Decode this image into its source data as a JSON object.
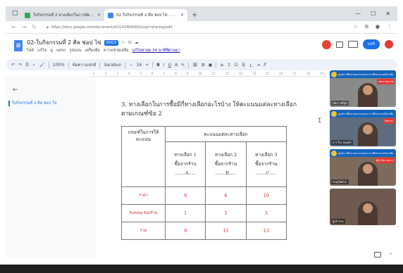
{
  "browser": {
    "tabs": [
      {
        "title": "ใบกิจกรรมที่ 2 ทางเลือกในการตัดสินใจ",
        "favicon_color": "#34a853",
        "active": false
      },
      {
        "title": "02-ใบกิจกรรมที่ 2 ศิล ช่อป ไข่ - Google เอกสาร",
        "favicon_color": "#4285f4",
        "active": true
      }
    ],
    "new_tab_glyph": "+",
    "url": "https://docs.google.com/document/d/1LXGN0b9IQi/usp=sharing/edit"
  },
  "doc": {
    "title": "02-ใบกิจกรรมที่ 2 ศิล ช่อป ไข่",
    "format_badge": "DOCX",
    "menus": [
      "ไฟล์",
      "แก้ไข",
      "ดู",
      "แทรก",
      "รูปแบบ",
      "เครื่องมือ",
      "ความช่วยเหลือ"
    ],
    "last_edit": "แก้ไขล่าสุด 34 นาทีที่ผ่านมา",
    "share_label": "แชร์"
  },
  "toolbar": {
    "zoom": "100%",
    "style": "ข้อความปกติ",
    "font": "Sarabun",
    "size": "16",
    "bold": "B",
    "italic": "I",
    "underline": "U",
    "text_color": "A"
  },
  "ruler": {
    "ticks": [
      "1",
      "2",
      "3",
      "4",
      "5",
      "6",
      "7",
      "8",
      "9",
      "10",
      "11",
      "12",
      "13",
      "14",
      "15",
      "16",
      "17",
      "18",
      "19"
    ]
  },
  "outline": {
    "item": "ใบกิจกรรมที่ 2 ศิล ช่อป ไข่"
  },
  "content": {
    "heading_line1": "3. ทางเลือกในการซื้อมีกี่ทางเลือกอะไรบ้าง ให้คะแนนแต่ละทางเลือก",
    "heading_line2": "ตามเกณฑ์ข้อ 2",
    "table": {
      "criteria_header": "เกณฑ์ในการให้คะแนน",
      "group_header": "คะแนนแต่ละทางเลือก",
      "options": [
        {
          "label": "ทางเลือก 1",
          "detail": "ซื้อจากร้าน",
          "blank": ".......A....."
        },
        {
          "label": "ทางเลือก 2",
          "detail": "ซื้อจากร้าน",
          "blank": ".......B....."
        },
        {
          "label": "ทางเลือก 3",
          "detail": "ซื้อจากร้าน",
          "blank": ".......C....."
        }
      ],
      "rows": [
        {
          "criterion": "ราคา",
          "scores": [
            "8",
            "6",
            "10"
          ]
        },
        {
          "criterion": "Rating ของร้าน",
          "scores": [
            "1",
            "5",
            "3"
          ]
        },
        {
          "criterion": "รวม",
          "scores": [
            "9",
            "11",
            "13"
          ]
        }
      ]
    }
  },
  "meet": {
    "tiles": [
      {
        "strip": "ศูนย์การศึกษานอกระบบและการศึกษาตามอัธยาศัย",
        "badge": "แต่งกายสุภาพ",
        "name": "ภัทรา ศรีสุข",
        "bg": "#8a8a8a"
      },
      {
        "strip": "ศูนย์การศึกษานอกระบบและการศึกษาตามอัธยาศัย",
        "badge": "วิทยากร",
        "name": "ส.ฯ วีระ ทองคำ",
        "bg": "#5d6d7e"
      },
      {
        "strip": "ศูนย์การศึกษานอกระบบและการศึกษาตามอัธยาศัย",
        "badge": "ผู้ดำเนินรายการ",
        "name": "ชาญวิทย์ ส.",
        "bg": "#7d6b5d"
      },
      {
        "strip": "",
        "badge": "",
        "name": "ผู้เข้าร่วม",
        "bg": "#6e5a4e"
      }
    ]
  }
}
